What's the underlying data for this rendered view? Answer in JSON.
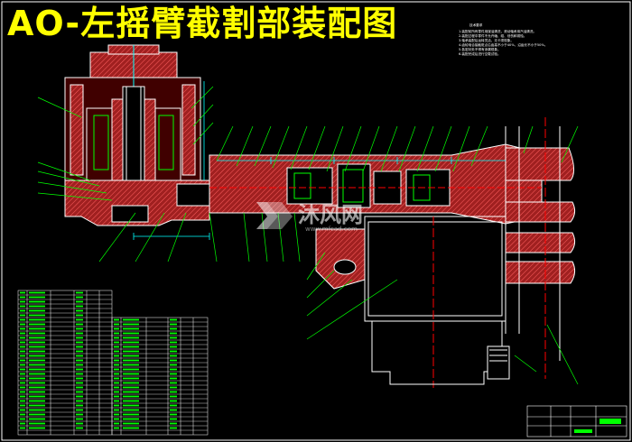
{
  "title": "AO-左摇臂截割部装配图",
  "watermark": {
    "text": "沐风网",
    "url": "www.mfcad.com"
  },
  "tech_requirements": {
    "heading": "技术要求",
    "items": [
      "1.装配前所有零件用煤油清洗，滚动轴承用汽油清洗。",
      "2.装配过程中零件不允许磕、碰、划伤和锈蚀。",
      "3.轴承装配后运转灵活，无卡滞现象。",
      "4.齿轮啮合接触斑点沿齿高不小于40%，沿齿长不小于50%。",
      "5.各密封处不得有渗漏现象。",
      "6.装配完成后进行空载试验。"
    ]
  },
  "colors": {
    "background": "#000000",
    "title": "#ffff00",
    "outline": "#ffffff",
    "leader": "#00ff00",
    "hatch": "#ff4040",
    "section": "#cc3333",
    "dim": "#00ffff",
    "center": "#ff0000",
    "table": "#ffffff",
    "table_text": "#00ff00"
  }
}
